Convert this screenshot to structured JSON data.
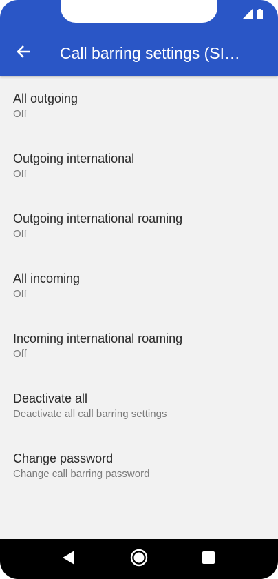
{
  "app_bar": {
    "title": "Call barring settings (SI…",
    "back_icon": "arrow-back-icon"
  },
  "status_bar": {
    "icons": [
      "signal-icon",
      "battery-icon"
    ]
  },
  "settings": [
    {
      "title": "All outgoing",
      "summary": "Off"
    },
    {
      "title": "Outgoing international",
      "summary": "Off"
    },
    {
      "title": "Outgoing international roaming",
      "summary": "Off"
    },
    {
      "title": "All incoming",
      "summary": "Off"
    },
    {
      "title": "Incoming international roaming",
      "summary": "Off"
    },
    {
      "title": "Deactivate all",
      "summary": "Deactivate all call barring settings"
    },
    {
      "title": "Change password",
      "summary": "Change call barring password"
    }
  ],
  "nav_bar": {
    "buttons": [
      "nav-back-icon",
      "nav-home-icon",
      "nav-recents-icon"
    ]
  },
  "colors": {
    "app_bar": "#2a56c6",
    "background": "#f2f2f2",
    "title_text": "#2b2b2b",
    "summary_text": "#7a7a7a"
  }
}
